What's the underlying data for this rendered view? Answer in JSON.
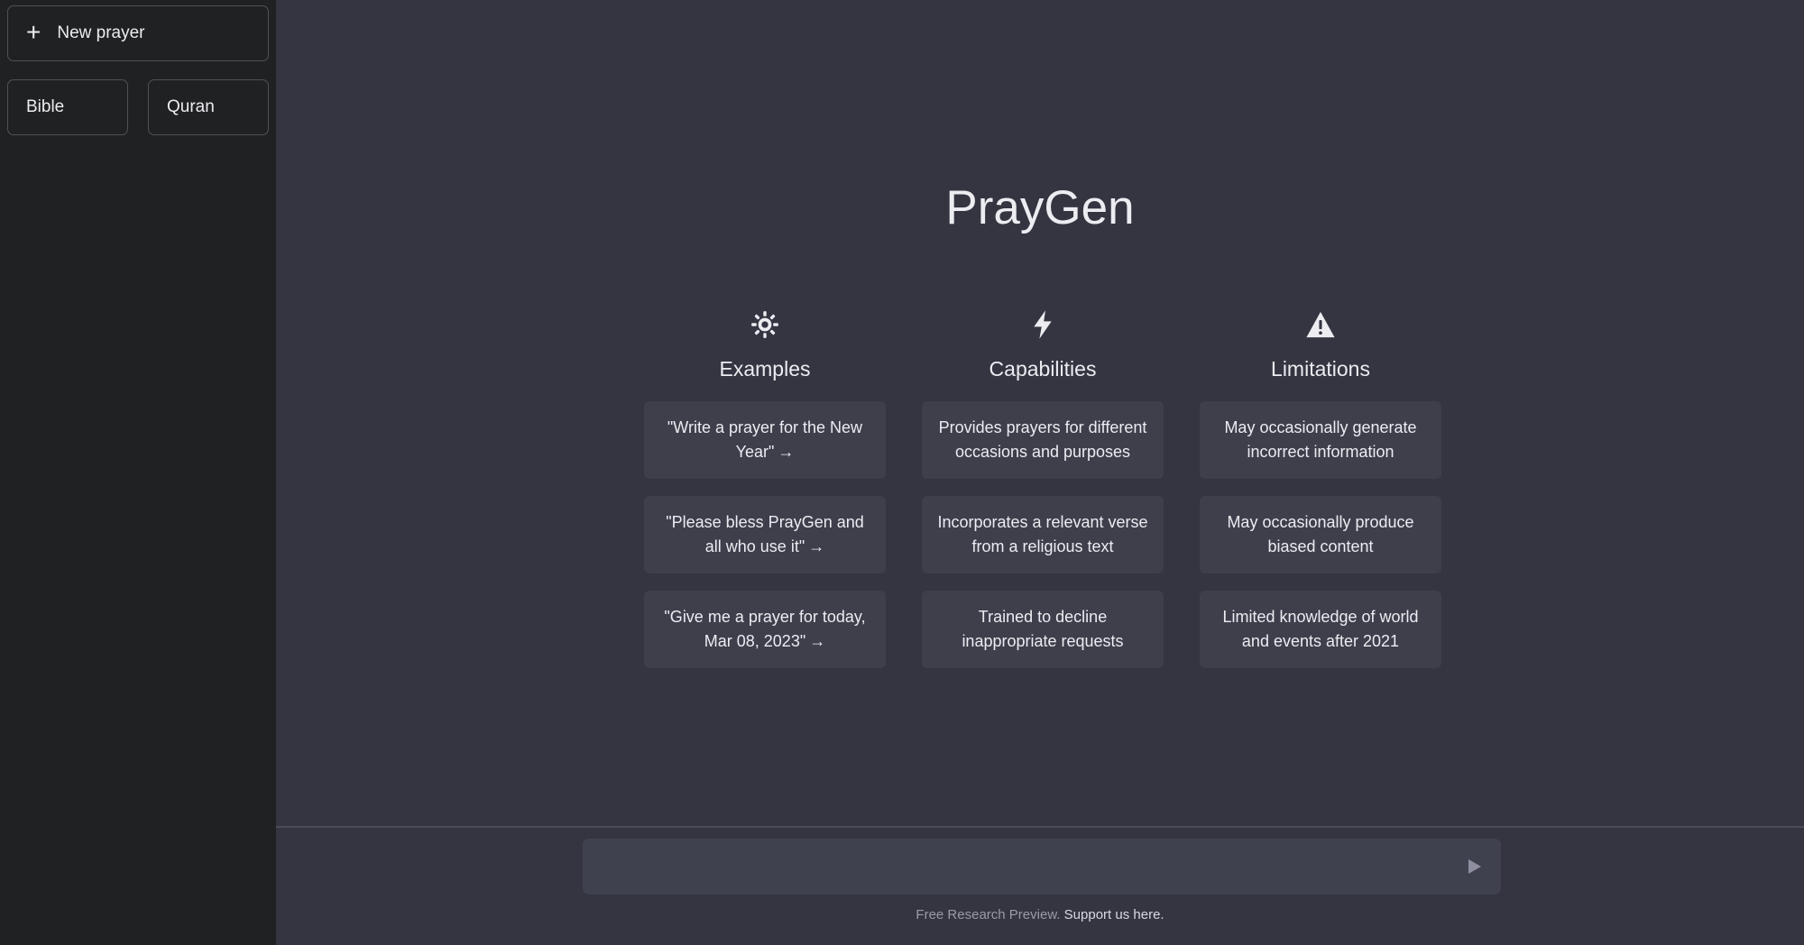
{
  "sidebar": {
    "new_prayer_label": "New prayer",
    "books": [
      {
        "label": "Bible"
      },
      {
        "label": "Quran"
      }
    ]
  },
  "main": {
    "title": "PrayGen",
    "columns": [
      {
        "icon": "sun-icon",
        "title": "Examples",
        "items": [
          "\"Write a prayer for the New Year\"",
          "\"Please bless PrayGen and all who use it\"",
          "\"Give me a prayer for today, Mar 08, 2023\""
        ],
        "arrow": "→"
      },
      {
        "icon": "lightning-icon",
        "title": "Capabilities",
        "items": [
          "Provides prayers for different occasions and purposes",
          "Incorporates a relevant verse from a religious text",
          "Trained to decline inappropriate requests"
        ]
      },
      {
        "icon": "warning-icon",
        "title": "Limitations",
        "items": [
          "May occasionally generate incorrect information",
          "May occasionally produce biased content",
          "Limited knowledge of world and events after 2021"
        ]
      }
    ]
  },
  "input": {
    "value": "",
    "placeholder": ""
  },
  "footer": {
    "text": "Free Research Preview.",
    "link": "Support us here."
  },
  "colors": {
    "sidebar_bg": "#202123",
    "main_bg": "#343541",
    "card_bg": "#3e3f4b",
    "input_bg": "#40414f",
    "text": "#ececf1"
  }
}
